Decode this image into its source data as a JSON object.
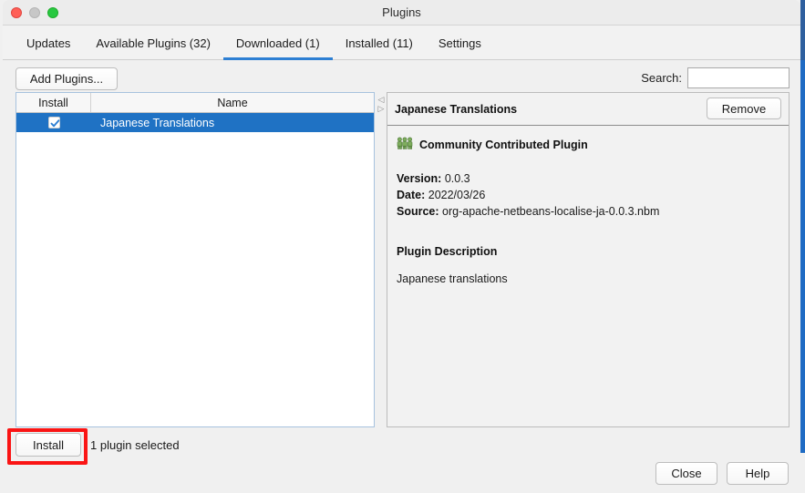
{
  "window": {
    "title": "Plugins",
    "controls": [
      "close",
      "minimize",
      "maximize"
    ]
  },
  "tabs": [
    {
      "label": "Updates",
      "active": false
    },
    {
      "label": "Available Plugins (32)",
      "active": false
    },
    {
      "label": "Downloaded (1)",
      "active": true
    },
    {
      "label": "Installed (11)",
      "active": false
    },
    {
      "label": "Settings",
      "active": false
    }
  ],
  "toolbar": {
    "add_plugins_label": "Add Plugins...",
    "search_label": "Search:",
    "search_value": "",
    "search_placeholder": ""
  },
  "table": {
    "columns": [
      "Install",
      "Name"
    ],
    "rows": [
      {
        "install_checked": true,
        "name": "Japanese Translations",
        "selected": true
      }
    ]
  },
  "detail": {
    "title": "Japanese Translations",
    "remove_label": "Remove",
    "community_label": "Community Contributed Plugin",
    "version_key": "Version:",
    "version_value": "0.0.3",
    "date_key": "Date:",
    "date_value": "2022/03/26",
    "source_key": "Source:",
    "source_value": "org-apache-netbeans-localise-ja-0.0.3.nbm",
    "description_heading": "Plugin Description",
    "description_text": "Japanese translations"
  },
  "footer": {
    "install_label": "Install",
    "selection_status": "1 plugin selected",
    "close_label": "Close",
    "help_label": "Help"
  },
  "colors": {
    "accent": "#2d7fd3",
    "selection": "#1f72c4",
    "highlight": "#fa1414",
    "edge_strip": "#1f6bc4"
  }
}
